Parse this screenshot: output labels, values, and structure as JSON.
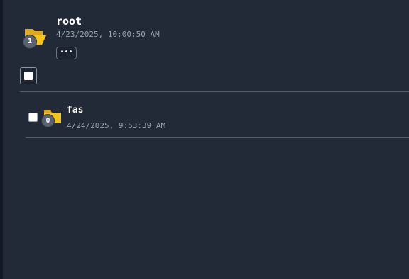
{
  "root": {
    "name": "root",
    "date": "4/23/2025, 10:00:50 AM",
    "child_count": "1",
    "more_label": "•••"
  },
  "children": [
    {
      "name": "fas",
      "date": "4/24/2025, 9:53:39 AM",
      "child_count": "0"
    }
  ],
  "colors": {
    "background": "#222a38",
    "folder": "#f5c518",
    "badge": "#5a6270",
    "divider": "#566070"
  },
  "icons": {
    "root_folder": "folder-open-icon",
    "child_folder": "folder-icon"
  }
}
